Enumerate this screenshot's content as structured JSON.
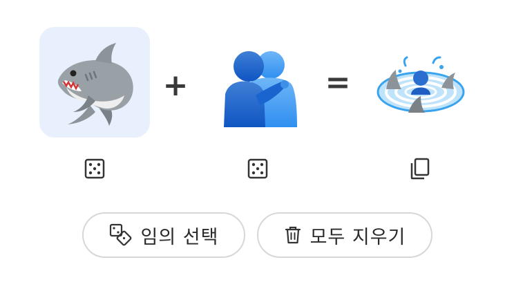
{
  "kitchen": {
    "left_emoji": "shark",
    "middle_emoji": "people-hugging",
    "result_emoji": "shark-and-person-in-water",
    "plus_symbol": "+",
    "equals_symbol": "=",
    "icons": {
      "left_randomize": "dice-icon",
      "middle_randomize": "dice-icon",
      "result_copy": "copy-icon"
    }
  },
  "actions": {
    "random_label": "임의 선택",
    "random_icon": "dice-icon",
    "clear_label": "모두 지우기",
    "clear_icon": "trash-icon"
  },
  "colors": {
    "selected_slot_bg": "#e8effd",
    "pill_border": "#d7d7d7",
    "text": "#2a2a2a"
  }
}
